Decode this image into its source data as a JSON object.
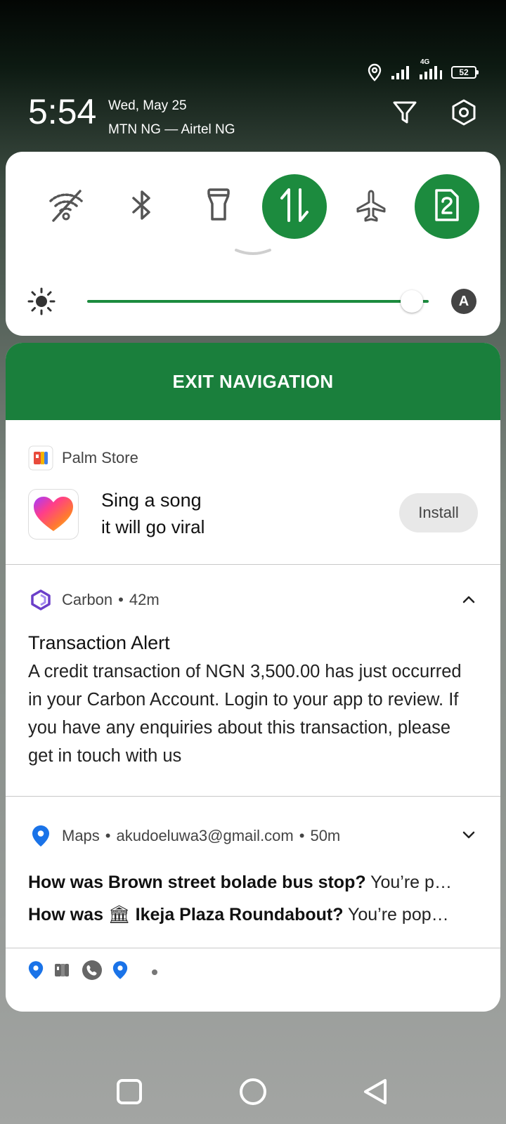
{
  "status_bar": {
    "network_type": "4G",
    "battery_level": "52",
    "icons": [
      "location-icon",
      "signal-icon",
      "signal-4g-icon",
      "battery-icon"
    ]
  },
  "header": {
    "time": "5:54",
    "date": "Wed, May 25",
    "carriers": "MTN NG — Airtel NG",
    "actions": [
      "filter-icon",
      "settings-icon"
    ]
  },
  "quick_settings": {
    "tiles": [
      {
        "name": "wifi-off-icon",
        "state": "off"
      },
      {
        "name": "bluetooth-icon",
        "state": "off"
      },
      {
        "name": "flashlight-icon",
        "state": "off"
      },
      {
        "name": "mobile-data-icon",
        "state": "on"
      },
      {
        "name": "airplane-icon",
        "state": "off"
      },
      {
        "name": "sim-2-icon",
        "state": "on"
      }
    ],
    "brightness": {
      "level": 0.95,
      "auto_label": "A"
    },
    "accent_color": "#1c8b3e"
  },
  "notifications": {
    "exit_nav_label": "EXIT NAVIGATION",
    "palm_store": {
      "app_name": "Palm Store",
      "title": "Sing a song",
      "subtitle": "it will go viral",
      "install_label": "Install"
    },
    "carbon": {
      "app_name": "Carbon",
      "time": "42m",
      "title": "Transaction Alert",
      "body": "A credit transaction of NGN 3,500.00 has just occurred in your Carbon Account. Login to your app to review. If you have any enquiries about this transaction, please get in touch with us"
    },
    "maps": {
      "app_name": "Maps",
      "account": "akudoeluwa3@gmail.com",
      "time": "50m",
      "line1_bold": "How was Brown street bolade bus stop?",
      "line1_rest": " You’re p…",
      "line2_prefix": "How was ",
      "line2_emoji": "🏛",
      "line2_bold": " Ikeja Plaza Roundabout?",
      "line2_rest": " You’re pop…"
    },
    "overflow_icons": [
      "maps-pin-icon",
      "palm-store-icon",
      "phone-icon",
      "maps-pin-icon"
    ]
  },
  "nav_bar": [
    "recents-button",
    "home-button",
    "back-button"
  ]
}
